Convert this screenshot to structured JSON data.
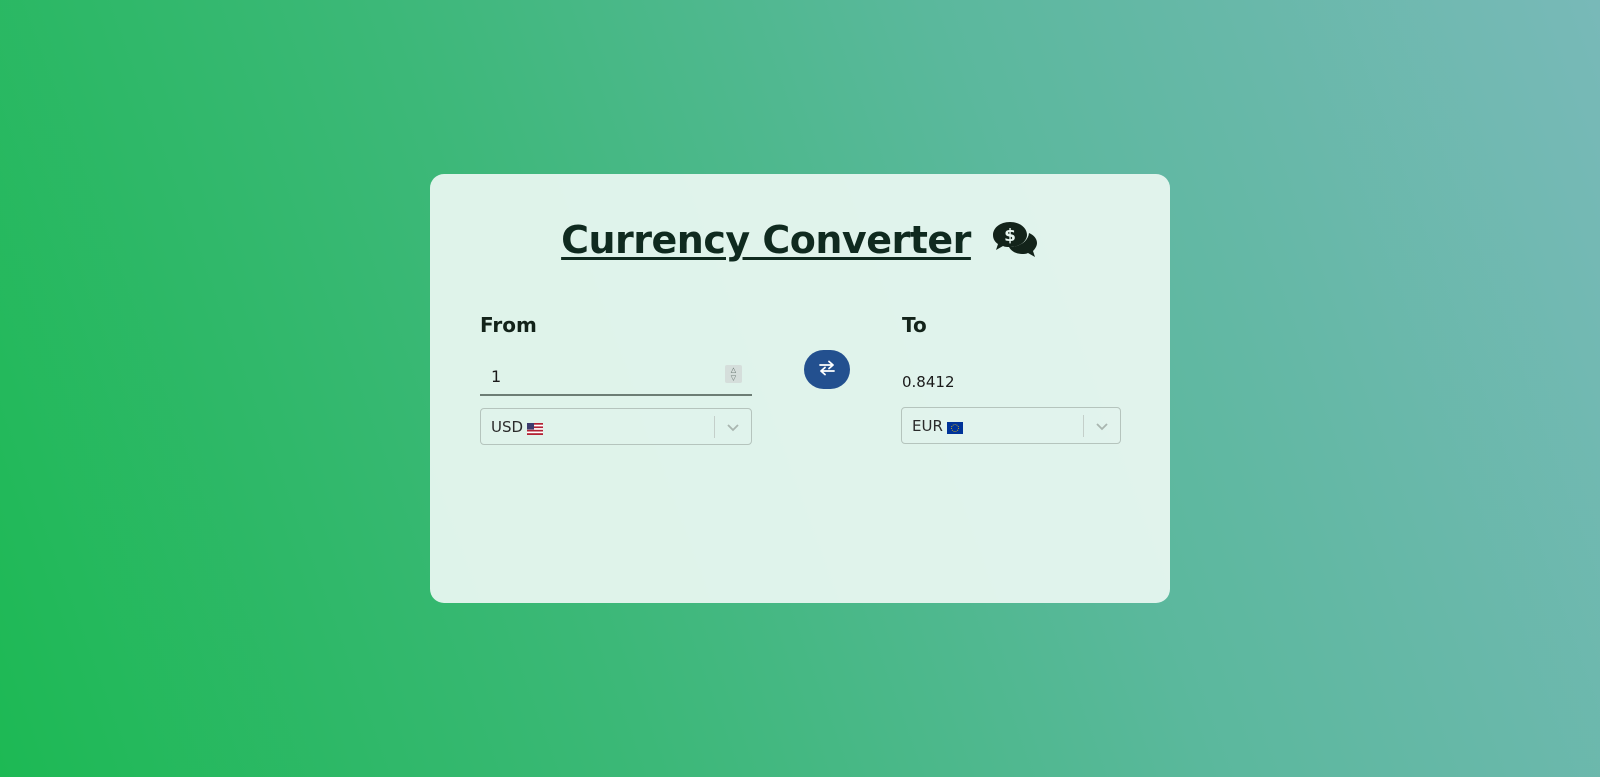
{
  "header": {
    "title": "Currency Converter",
    "icon": "money-chat-icon"
  },
  "from": {
    "label": "From",
    "amount": "1",
    "currency": "USD",
    "flag": "us-flag-icon"
  },
  "to": {
    "label": "To",
    "result": "0.8412",
    "currency": "EUR",
    "flag": "eu-flag-icon"
  },
  "swap": {
    "icon": "swap-arrows-icon"
  },
  "colors": {
    "accent": "#23508f",
    "card": "#e8f6f0",
    "text": "#0f2a1f",
    "gradient_start": "#1db954",
    "gradient_end": "#78b9b8"
  }
}
